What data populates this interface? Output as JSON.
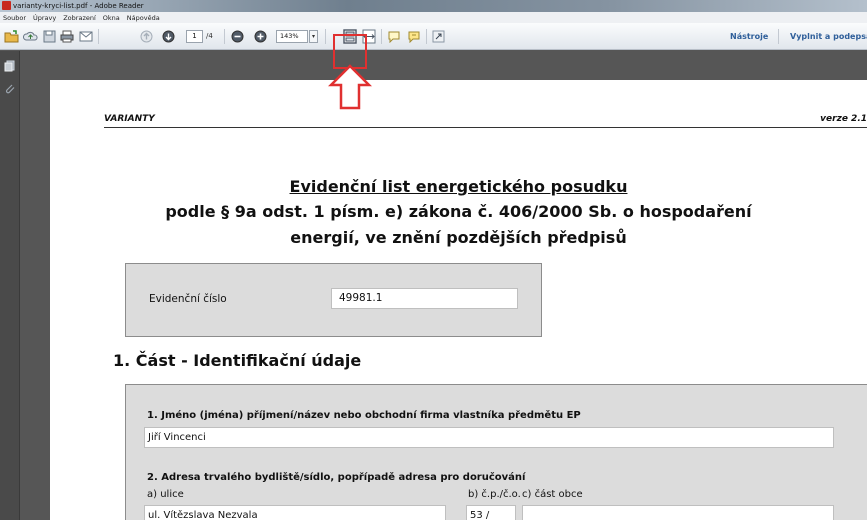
{
  "window": {
    "title": "varianty-kryci-list.pdf - Adobe Reader"
  },
  "menu": [
    "Soubor",
    "Úpravy",
    "Zobrazení",
    "Okna",
    "Nápověda"
  ],
  "toolbar": {
    "page_current": "1",
    "page_total": "/4",
    "zoom": "143%",
    "zoom_arrow": "▾",
    "tools_label": "Nástroje",
    "sign_label": "Vyplnit a podepsat"
  },
  "document": {
    "header_left": "VARIANTY",
    "header_right": "verze 2.1",
    "title": "Evidenční list energetického posudku",
    "subtitle_line1": "podle § 9a odst. 1 písm. e) zákona č. 406/2000 Sb. o hospodaření",
    "subtitle_line2": "energií, ve znění pozdějších předpisů",
    "evid_label": "Evidenční číslo",
    "evid_value": "49981.1",
    "section1_heading": "1. Část - Identifikační údaje",
    "q1_label": "1. Jméno (jména) příjmení/název nebo obchodní firma vlastníka předmětu EP",
    "q1_value": "Jiří Vincenci",
    "q2_label": "2. Adresa trvalého bydliště/sídlo, popřípadě adresa pro doručování",
    "q2a_label": "a) ulice",
    "q2b_label": "b) č.p./č.o.",
    "q2c_label": "c) část obce",
    "q2a_value": "ul. Vítězslava Nezvala",
    "q2b_value": "53 /",
    "q2c_value": ""
  },
  "colors": {
    "annotation": "#e03030",
    "link": "#2f5f9a"
  }
}
